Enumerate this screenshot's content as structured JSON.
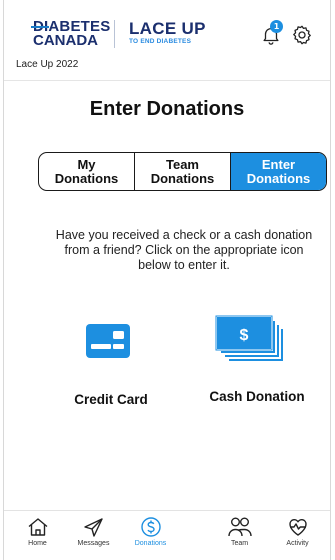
{
  "header": {
    "logo_diabetes_line1": "DIABETES",
    "logo_diabetes_line2": "CANADA",
    "logo_laceup_line1": "LACE UP",
    "logo_laceup_line2": "TO END DIABETES",
    "notification_count": "1",
    "event_name": "Lace Up 2022"
  },
  "page": {
    "title": "Enter Donations",
    "instructions": "Have you received a check or a cash donation from a friend? Click on the appropriate icon below to enter it."
  },
  "tabs": [
    {
      "label": "My Donations",
      "active": false
    },
    {
      "label": "Team Donations",
      "active": false
    },
    {
      "label": "Enter Donations",
      "active": true
    }
  ],
  "tab_labels": {
    "my_l1": "My",
    "my_l2": "Donations",
    "team_l1": "Team",
    "team_l2": "Donations",
    "enter_l1": "Enter",
    "enter_l2": "Donations"
  },
  "options": {
    "credit_card": {
      "label": "Credit Card",
      "icon": "credit-card-icon"
    },
    "cash": {
      "label": "Cash Donation",
      "icon": "cash-icon",
      "symbol": "$"
    }
  },
  "nav": [
    {
      "label": "Home",
      "icon": "home-icon"
    },
    {
      "label": "Messages",
      "icon": "send-icon"
    },
    {
      "label": "Donations",
      "icon": "dollar-icon",
      "active": true
    },
    {
      "label": "Team",
      "icon": "team-icon"
    },
    {
      "label": "Activity",
      "icon": "heart-pulse-icon"
    }
  ],
  "colors": {
    "accent": "#1d8fe0",
    "brand_navy": "#1b2f6e"
  }
}
